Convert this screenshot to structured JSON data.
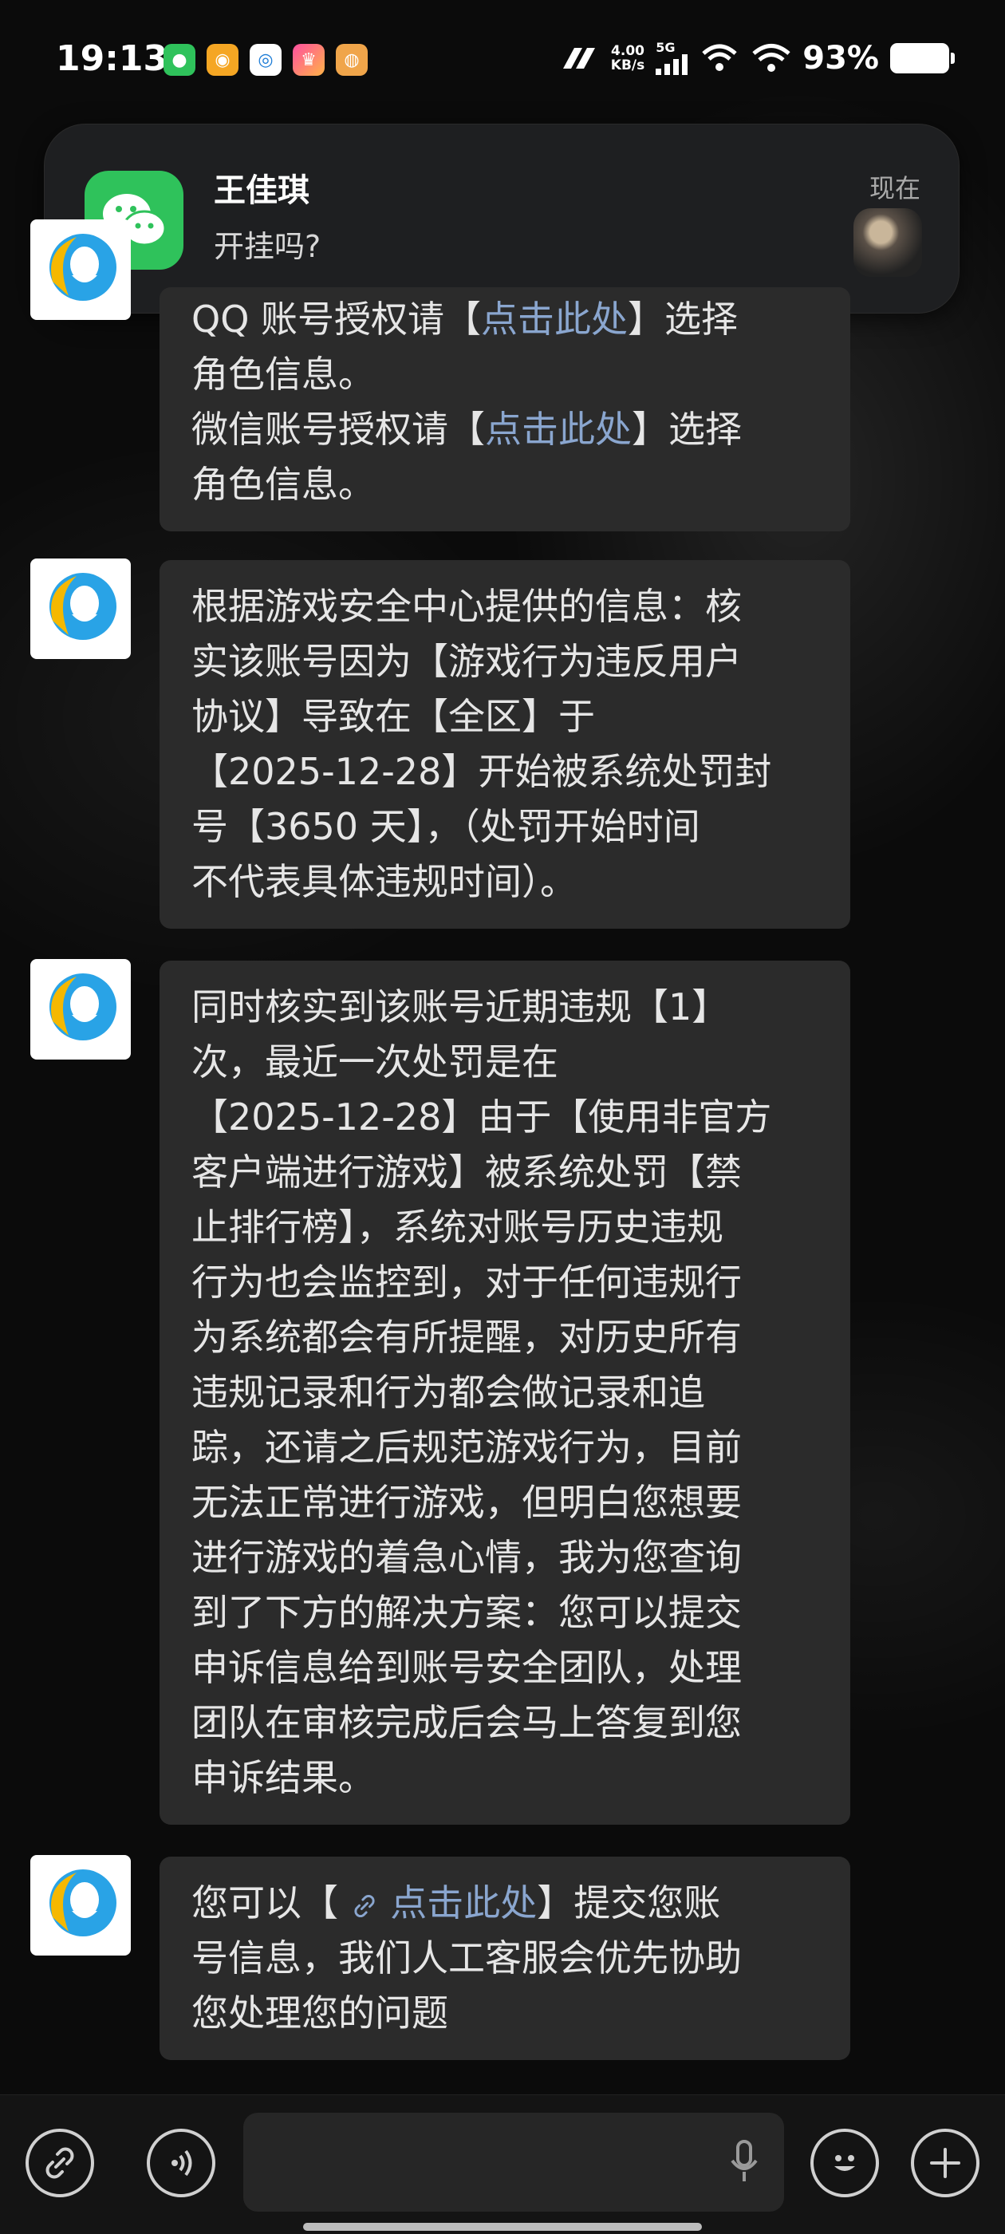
{
  "status_bar": {
    "time": "19:13",
    "speed_value": "4.00",
    "speed_unit": "KB/s",
    "network": "5G",
    "battery": "93%"
  },
  "notification": {
    "app_icon": "wechat-icon",
    "sender": "王佳琪",
    "message": "开挂吗?",
    "time": "现在"
  },
  "chat": {
    "messages": [
      {
        "lines": [
          [
            "QQ 账号授权请【",
            {
              "link": "点击此处"
            },
            "】选择"
          ],
          [
            "角色信息。"
          ],
          [
            "微信账号授权请【",
            {
              "link": "点击此处"
            },
            "】选择"
          ],
          [
            "角色信息。"
          ]
        ]
      },
      {
        "lines": [
          [
            "根据游戏安全中心提供的信息：核"
          ],
          [
            "实该账号因为【游戏行为违反用户"
          ],
          [
            "协议】导致在【全区】于"
          ],
          [
            "【2025-12-28】开始被系统处罚封"
          ],
          [
            "号【3650 天】，（处罚开始时间"
          ],
          [
            "不代表具体违规时间）。"
          ]
        ]
      },
      {
        "lines": [
          [
            "同时核实到该账号近期违规【1】"
          ],
          [
            "次，最近一次处罚是在"
          ],
          [
            "【2025-12-28】由于【使用非官方"
          ],
          [
            "客户端进行游戏】被系统处罚【禁"
          ],
          [
            "止排行榜】，系统对账号历史违规"
          ],
          [
            "行为也会监控到，对于任何违规行"
          ],
          [
            "为系统都会有所提醒，对历史所有"
          ],
          [
            "违规记录和行为都会做记录和追"
          ],
          [
            "踪，还请之后规范游戏行为，目前"
          ],
          [
            "无法正常进行游戏，但明白您想要"
          ],
          [
            "进行游戏的着急心情，我为您查询"
          ],
          [
            "到了下方的解决方案：您可以提交"
          ],
          [
            "申诉信息给到账号安全团队，处理"
          ],
          [
            "团队在审核完成后会马上答复到您"
          ],
          [
            "申诉结果。"
          ]
        ]
      },
      {
        "lines": [
          [
            "您可以【 ",
            {
              "icon": "link-icon"
            },
            " ",
            {
              "link": "点击此处"
            },
            "】提交您账"
          ],
          [
            "号信息，我们人工客服会优先协助"
          ],
          [
            "您处理您的问题"
          ]
        ]
      }
    ]
  },
  "bottom_bar": {
    "input_placeholder": "",
    "icons": [
      "link-icon",
      "voice-icon",
      "mic-icon",
      "emoji-icon",
      "plus-icon"
    ]
  }
}
